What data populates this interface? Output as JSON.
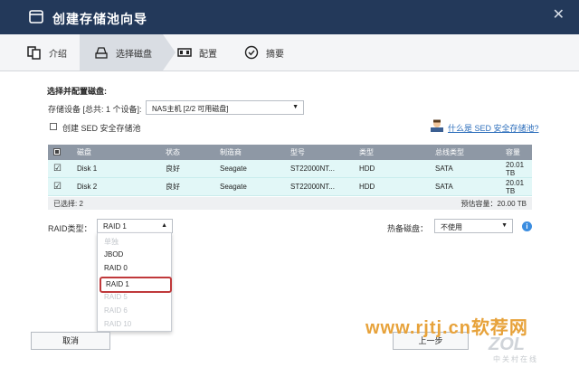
{
  "window": {
    "title": "创建存储池向导",
    "close_glyph": "✕"
  },
  "steps": [
    {
      "label": "介绍",
      "icon": "intro-icon"
    },
    {
      "label": "选择磁盘",
      "icon": "disk-icon"
    },
    {
      "label": "配置",
      "icon": "config-icon"
    },
    {
      "label": "摘要",
      "icon": "check-circle-icon"
    }
  ],
  "section": {
    "heading": "选择并配置磁盘:",
    "device_label": "存储设备 [总共: 1 个设备]:",
    "device_value": "NAS主机 [2/2 可用磁盘]",
    "sed_label": "创建 SED 安全存储池",
    "sed_link": "什么是 SED 安全存储池?"
  },
  "table": {
    "headers": [
      "磁盘",
      "状态",
      "制造商",
      "型号",
      "类型",
      "总线类型",
      "容量"
    ],
    "rows": [
      [
        "Disk 1",
        "良好",
        "Seagate",
        "ST22000NT...",
        "HDD",
        "SATA",
        "20.01 TB"
      ],
      [
        "Disk 2",
        "良好",
        "Seagate",
        "ST22000NT...",
        "HDD",
        "SATA",
        "20.01 TB"
      ]
    ],
    "selected_text": "已选择: 2",
    "estimated_text": "预估容量：20.00 TB"
  },
  "raid": {
    "label": "RAID类型：",
    "value": "RAID 1",
    "options": [
      {
        "label": "单独",
        "disabled": true
      },
      {
        "label": "JBOD",
        "disabled": false
      },
      {
        "label": "RAID 0",
        "disabled": false
      },
      {
        "label": "RAID 1",
        "disabled": false,
        "highlighted": true
      },
      {
        "label": "RAID 5",
        "disabled": true
      },
      {
        "label": "RAID 6",
        "disabled": true
      },
      {
        "label": "RAID 10",
        "disabled": true
      }
    ]
  },
  "hotspare": {
    "label": "热备磁盘：",
    "value": "不使用",
    "info": "i"
  },
  "buttons": {
    "cancel": "取消",
    "back": "上一步"
  },
  "watermark": {
    "site": "www.rjtj.cn软荐网",
    "logo": "ZOL",
    "logo_sub": "中关村在线"
  },
  "colors": {
    "titlebar": "#23395a",
    "table_header": "#8e98a5",
    "row_bg": "#e2f7f7",
    "highlight": "#c0393b",
    "link": "#2b6dbb",
    "watermark": "#e7a23a"
  }
}
